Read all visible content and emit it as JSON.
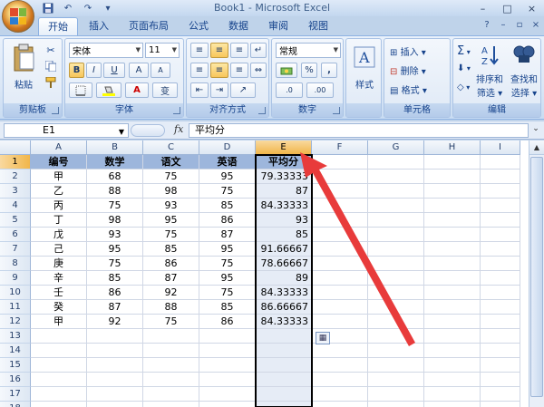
{
  "window": {
    "title": "Book1 - Microsoft Excel",
    "controls": [
      "–",
      "□",
      "×"
    ]
  },
  "qat": {
    "undo": "↶",
    "redo": "↷"
  },
  "tabs": [
    "开始",
    "插入",
    "页面布局",
    "公式",
    "数据",
    "审阅",
    "视图"
  ],
  "ribbon": {
    "clipboard": {
      "label": "剪贴板",
      "paste": "粘贴"
    },
    "font": {
      "label": "字体",
      "name": "宋体",
      "size": "11",
      "bold": "B",
      "italic": "I",
      "underline": "U",
      "grow": "A",
      "shrink": "A",
      "color_letter": "A",
      "wen": "变"
    },
    "alignment": {
      "label": "对齐方式"
    },
    "number": {
      "label": "数字",
      "format": "常规",
      "percent": "%",
      "comma": ",",
      "inc": ".0",
      "dec": ".00"
    },
    "styles": {
      "label": "样式"
    },
    "cells": {
      "label": "单元格",
      "insert": "插入",
      "delete": "删除",
      "format": "格式"
    },
    "editing": {
      "label": "编辑",
      "sigma": "Σ",
      "sort": "排序和",
      "sort2": "筛选",
      "find": "查找和",
      "find2": "选择"
    }
  },
  "formula_bar": {
    "name_box": "E1",
    "fx": "fx",
    "content": "平均分"
  },
  "sheet": {
    "columns": [
      "A",
      "B",
      "C",
      "D",
      "E",
      "F",
      "G",
      "H",
      "I"
    ],
    "rows": [
      "1",
      "2",
      "3",
      "4",
      "5",
      "6",
      "7",
      "8",
      "9",
      "10",
      "11",
      "12",
      "13",
      "14",
      "15",
      "16",
      "17",
      "18"
    ],
    "headers": [
      "编号",
      "数学",
      "语文",
      "英语",
      "平均分"
    ],
    "data": [
      [
        "甲",
        "68",
        "75",
        "95",
        "79.33333"
      ],
      [
        "乙",
        "88",
        "98",
        "75",
        "87"
      ],
      [
        "丙",
        "75",
        "93",
        "85",
        "84.33333"
      ],
      [
        "丁",
        "98",
        "95",
        "86",
        "93"
      ],
      [
        "戊",
        "93",
        "75",
        "87",
        "85"
      ],
      [
        "己",
        "95",
        "85",
        "95",
        "91.66667"
      ],
      [
        "庚",
        "75",
        "86",
        "75",
        "78.66667"
      ],
      [
        "辛",
        "85",
        "87",
        "95",
        "89"
      ],
      [
        "壬",
        "86",
        "92",
        "75",
        "84.33333"
      ],
      [
        "癸",
        "87",
        "88",
        "85",
        "86.66667"
      ],
      [
        "甲",
        "92",
        "75",
        "86",
        "84.33333"
      ]
    ]
  },
  "colors": {
    "accent": "#f1b64a",
    "header_fill": "#9db6dc",
    "arrow": "#e83b3b"
  }
}
